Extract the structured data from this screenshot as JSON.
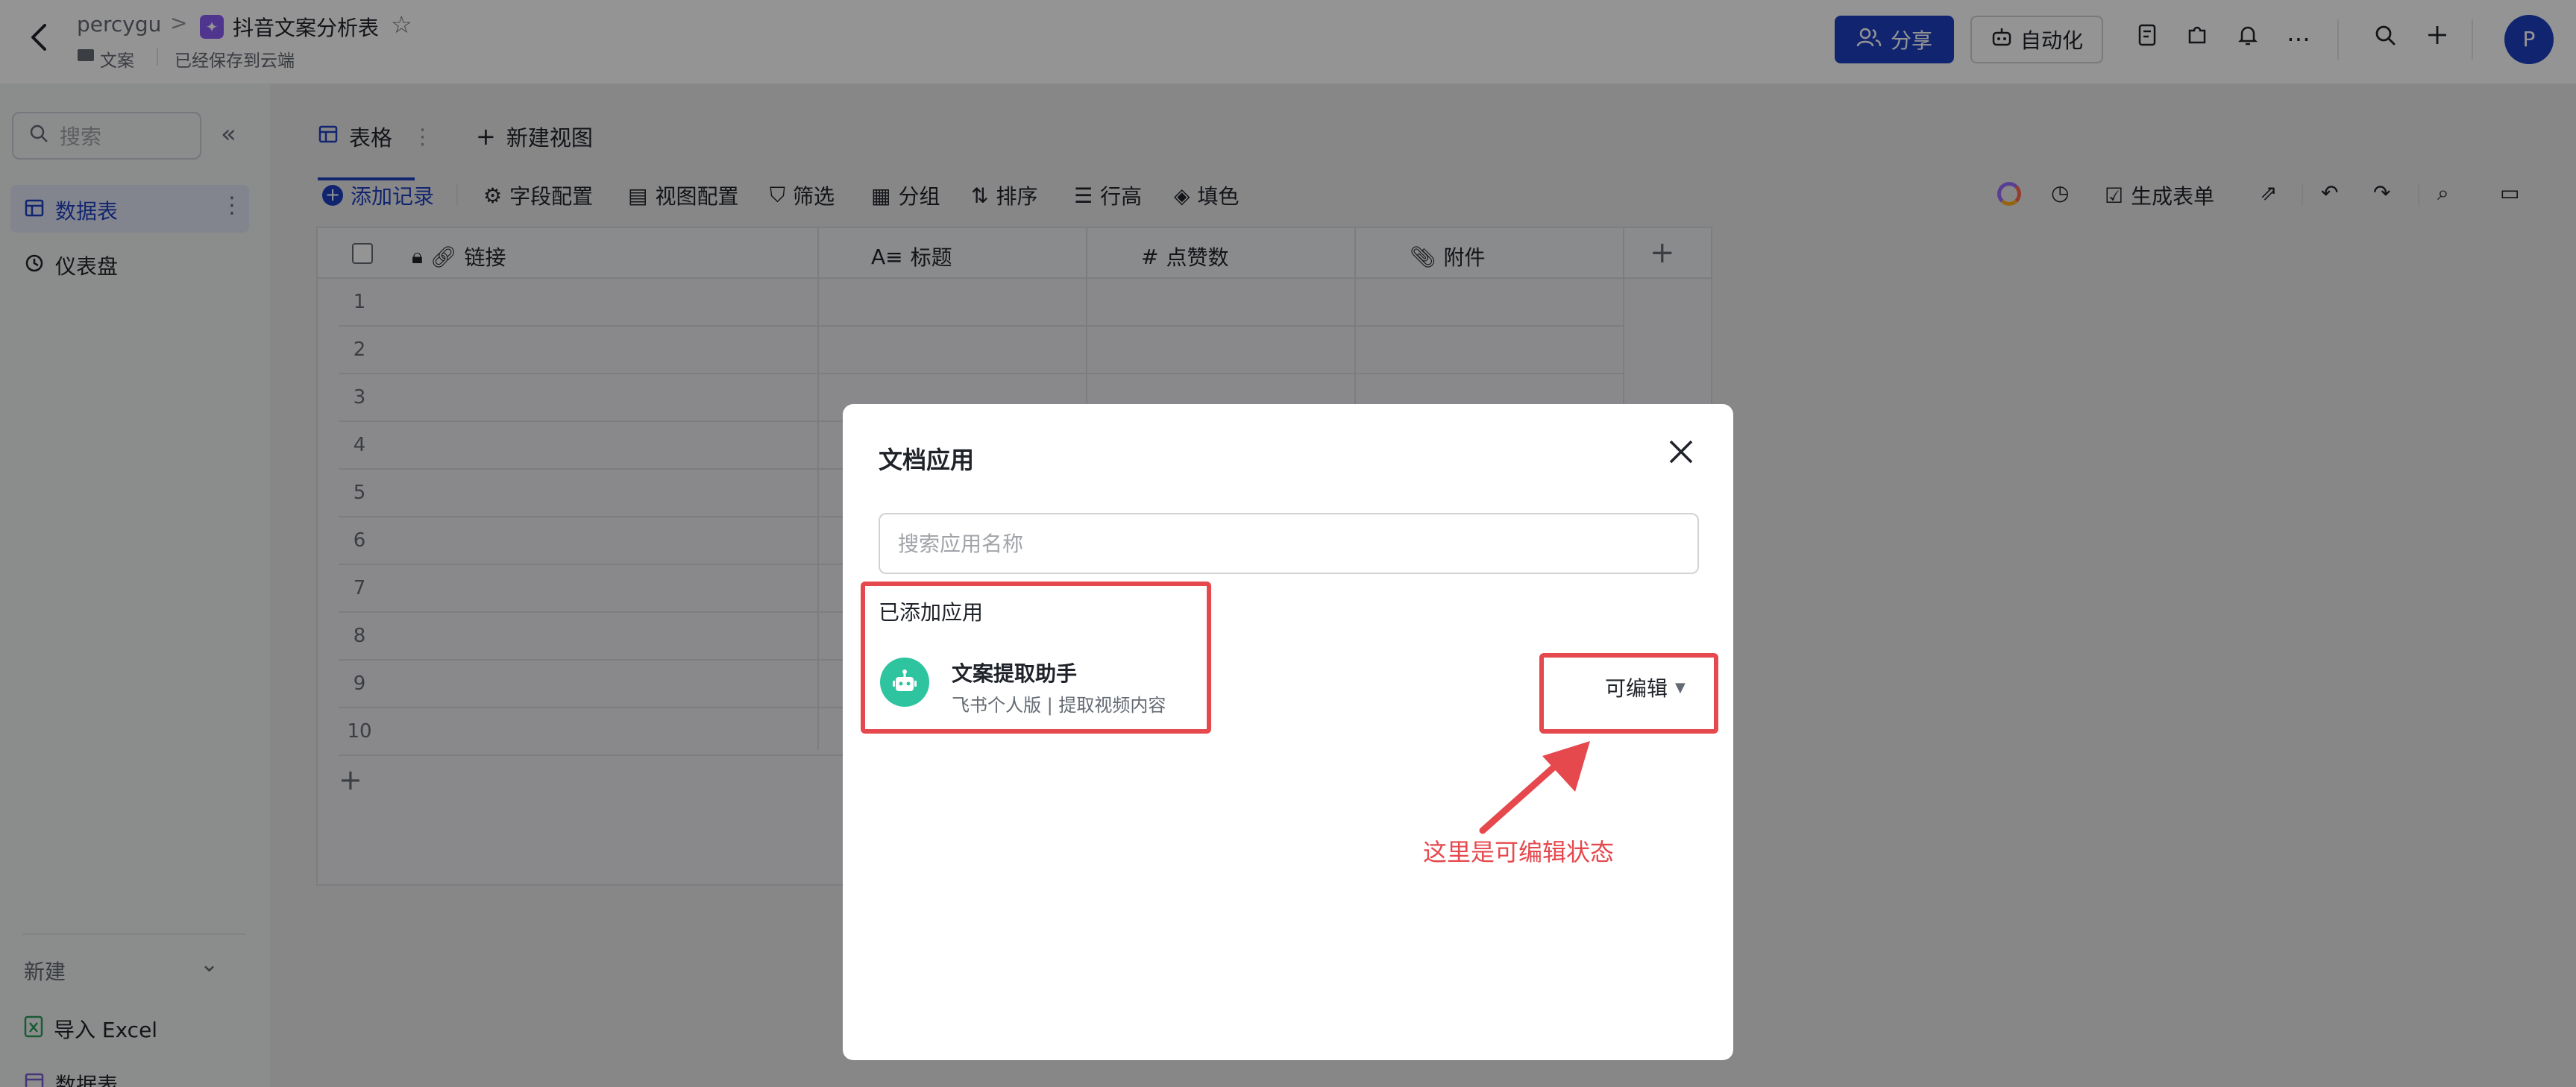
{
  "topbar": {
    "owner": "percygu",
    "separator": ">",
    "doc_title": "抖音文案分析表",
    "folder": "文案",
    "save_status": "已经保存到云端",
    "share_label": "分享",
    "automation_label": "自动化",
    "avatar_letter": "P",
    "accent_color": "#1e3fbf"
  },
  "sidebar": {
    "search_placeholder": "搜索",
    "items": [
      {
        "label": "数据表",
        "icon": "table-icon",
        "active": true
      },
      {
        "label": "仪表盘",
        "icon": "dashboard-icon",
        "active": false
      }
    ],
    "new_label": "新建",
    "new_items": [
      {
        "label": "导入 Excel",
        "icon": "excel-icon"
      },
      {
        "label": "数据表",
        "icon": "table-icon"
      }
    ]
  },
  "main": {
    "tabs": [
      {
        "label": "表格",
        "active": true
      }
    ],
    "new_view_label": "新建视图",
    "toolbar": {
      "add_record": "添加记录",
      "field_config": "字段配置",
      "view_config": "视图配置",
      "filter": "筛选",
      "group": "分组",
      "sort": "排序",
      "row_height": "行高",
      "fill_color": "填色",
      "generate_form": "生成表单"
    },
    "grid": {
      "columns": [
        {
          "label": "链接",
          "icon": "link-icon"
        },
        {
          "label": "标题",
          "icon": "text-icon"
        },
        {
          "label": "点赞数",
          "icon": "number-icon"
        },
        {
          "label": "附件",
          "icon": "attachment-icon"
        }
      ],
      "row_numbers": [
        "1",
        "2",
        "3",
        "4",
        "5",
        "6",
        "7",
        "8",
        "9",
        "10"
      ]
    }
  },
  "modal": {
    "title": "文档应用",
    "search_placeholder": "搜索应用名称",
    "section_label": "已添加应用",
    "app": {
      "name": "文案提取助手",
      "desc": "飞书个人版 | 提取视频内容",
      "permission": "可编辑",
      "icon_color": "#2ec4a0"
    }
  },
  "annotation": {
    "text": "这里是可编辑状态",
    "color": "#e5484d"
  }
}
